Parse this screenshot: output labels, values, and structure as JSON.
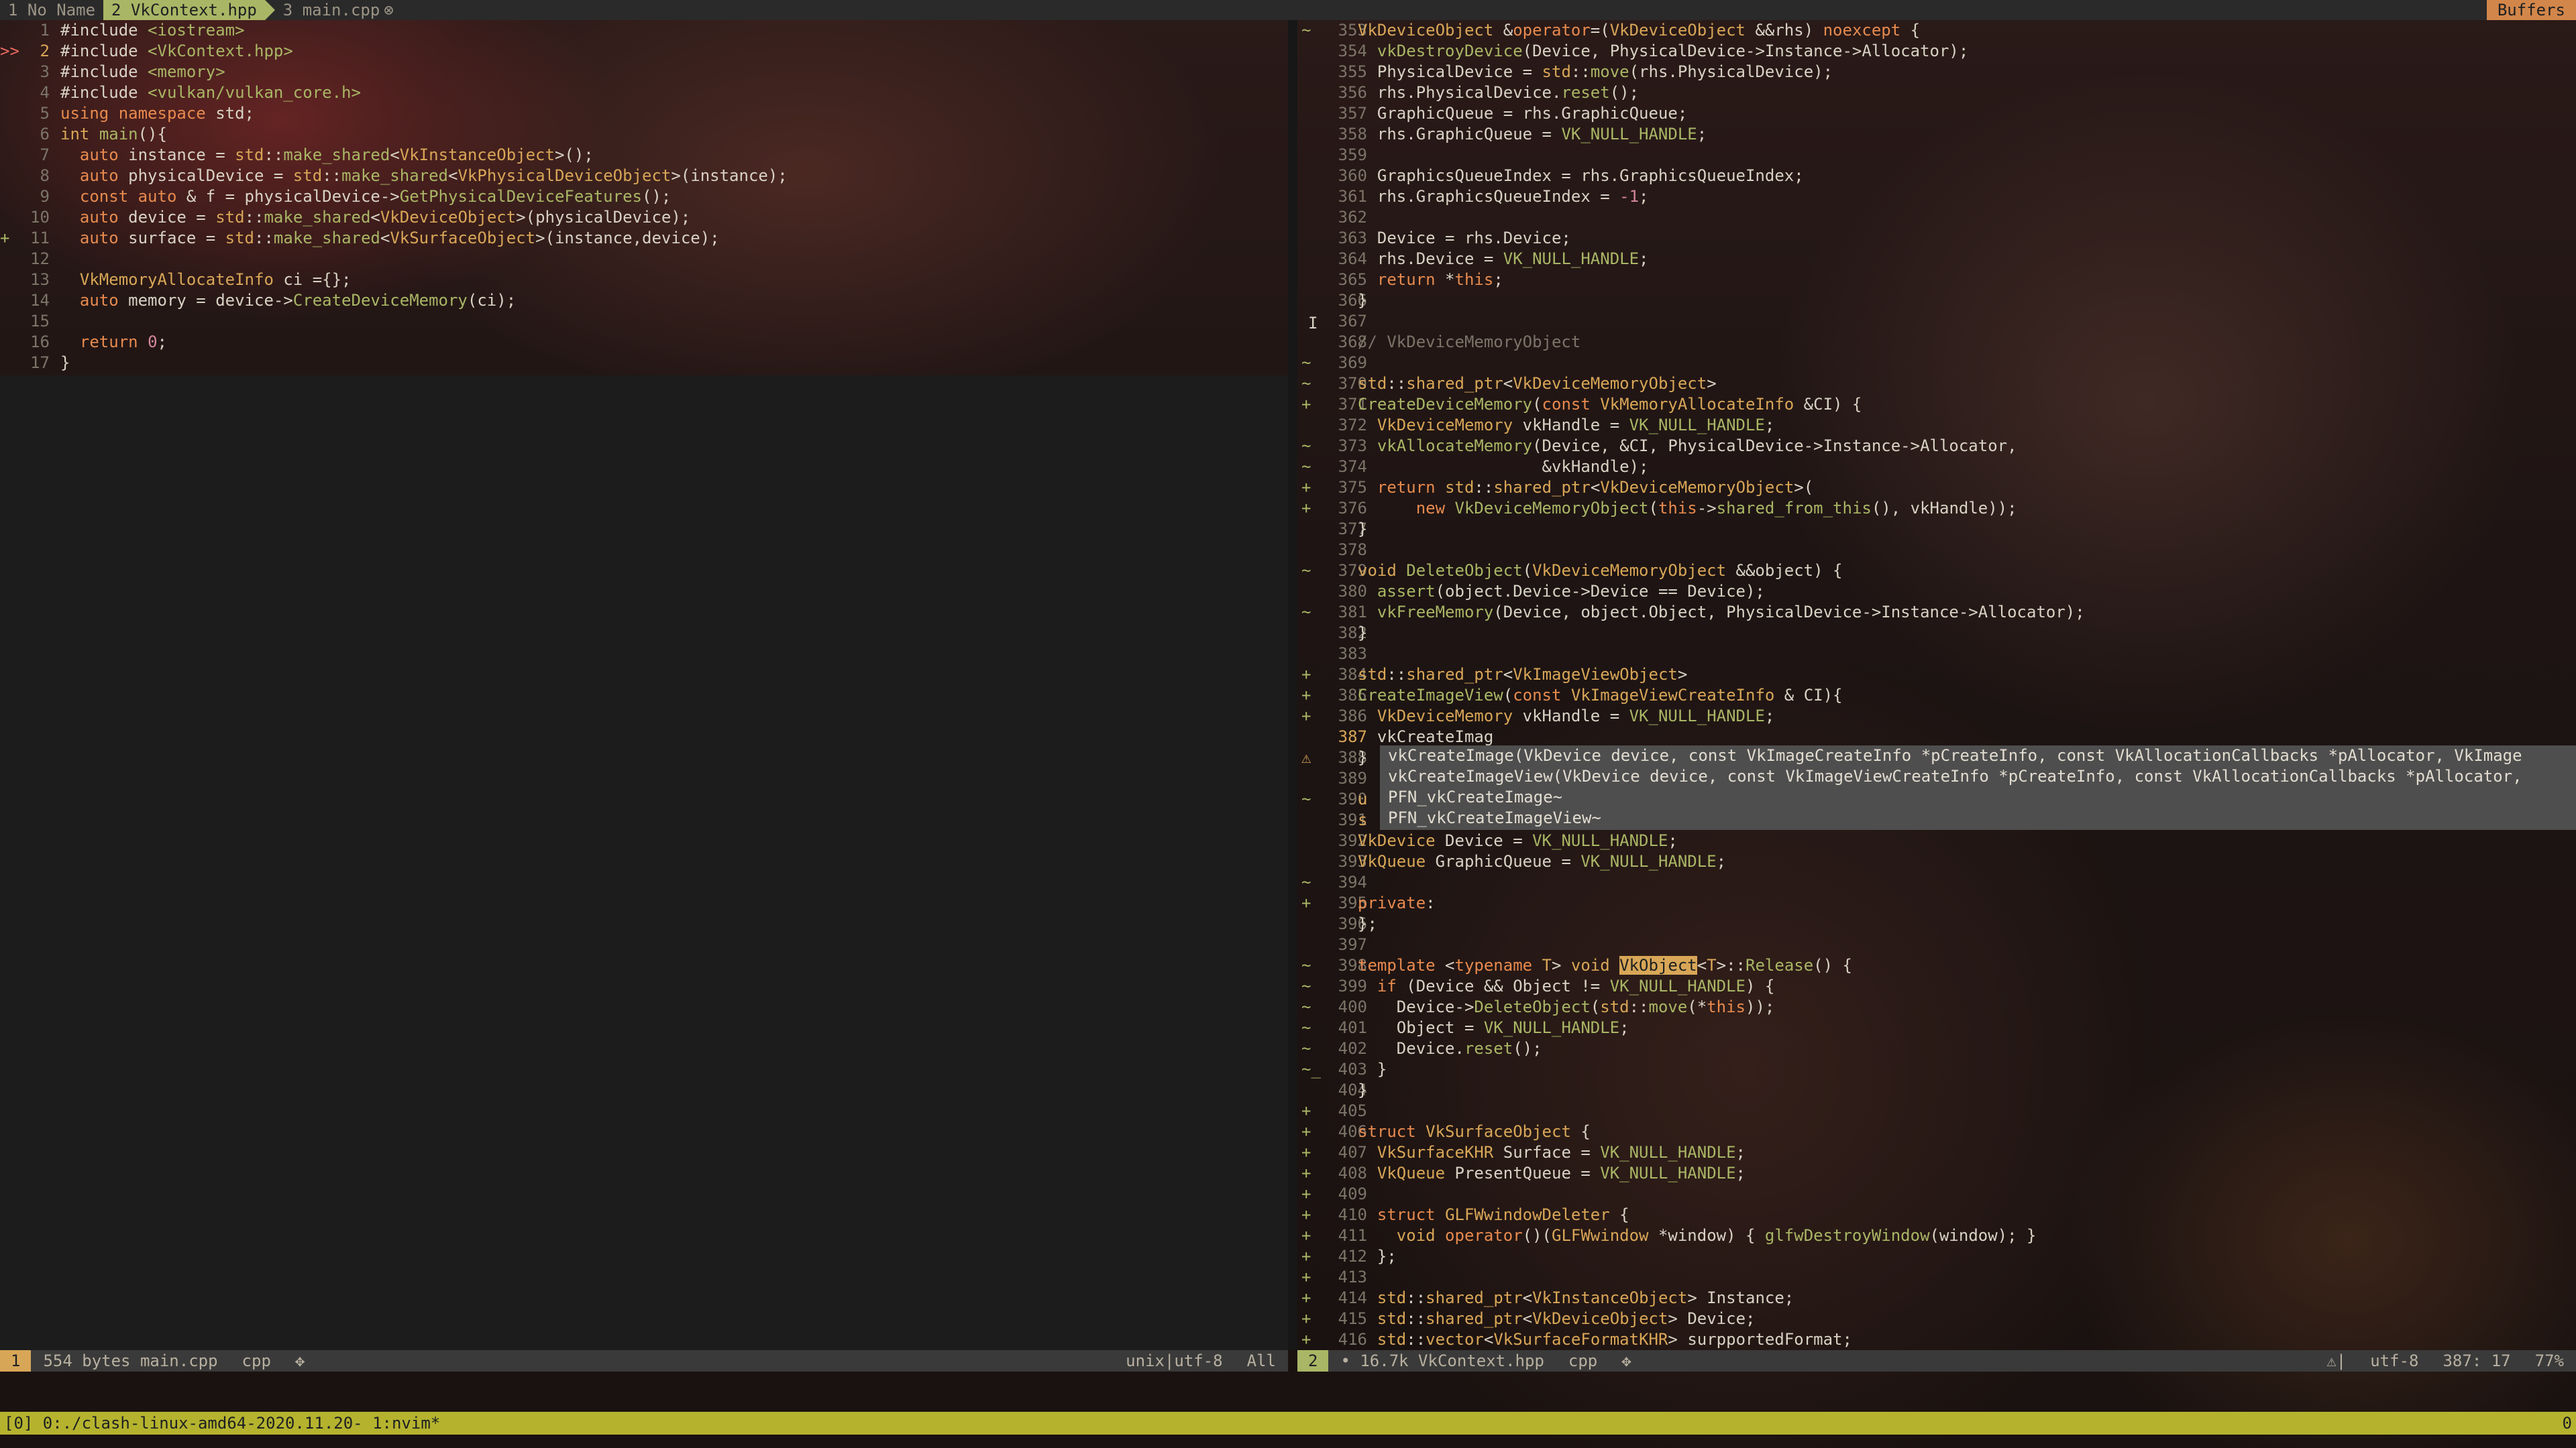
{
  "tabline": {
    "tabs": [
      {
        "label": "1 No Name",
        "active": false
      },
      {
        "label": "2 VkContext.hpp",
        "active": true
      },
      {
        "label": "3 main.cpp",
        "active": false,
        "modified_marker": "⊗"
      }
    ],
    "buffers_label": "Buffers"
  },
  "left_pane": {
    "file": "main.cpp",
    "lines": [
      {
        "n": "1",
        "sign": "",
        "html": "#include <span class=\"s\">&lt;iostream&gt;</span>"
      },
      {
        "n": "2",
        "sign": ">>",
        "cur": true,
        "html": "#include <span class=\"s\">&lt;VkContext.hpp&gt;</span>"
      },
      {
        "n": "3",
        "sign": "",
        "html": "#include <span class=\"s\">&lt;memory&gt;</span>"
      },
      {
        "n": "4",
        "sign": "",
        "html": "#include <span class=\"s\">&lt;vulkan/vulkan_core.h&gt;</span>"
      },
      {
        "n": "5",
        "sign": "",
        "html": "<span class=\"k\">using</span> <span class=\"k\">namespace</span> std;"
      },
      {
        "n": "6",
        "sign": "",
        "html": "<span class=\"t\">int</span> <span class=\"f\">main</span>(){"
      },
      {
        "n": "7",
        "sign": "",
        "html": "  <span class=\"k\">auto</span> instance = <span class=\"t\">std</span>::<span class=\"f\">make_shared</span>&lt;<span class=\"t\">VkInstanceObject</span>&gt;();"
      },
      {
        "n": "8",
        "sign": "",
        "html": "  <span class=\"k\">auto</span> physicalDevice = <span class=\"t\">std</span>::<span class=\"f\">make_shared</span>&lt;<span class=\"t\">VkPhysicalDeviceObject</span>&gt;(instance);"
      },
      {
        "n": "9",
        "sign": "",
        "html": "  <span class=\"k\">const</span> <span class=\"k\">auto</span> &amp; f = physicalDevice-&gt;<span class=\"f\">GetPhysicalDeviceFeatures</span>();"
      },
      {
        "n": "10",
        "sign": "",
        "html": "  <span class=\"k\">auto</span> device = <span class=\"t\">std</span>::<span class=\"f\">make_shared</span>&lt;<span class=\"t\">VkDeviceObject</span>&gt;(physicalDevice);"
      },
      {
        "n": "11",
        "sign": "+",
        "html": "  <span class=\"k\">auto</span> surface = <span class=\"t\">std</span>::<span class=\"f\">make_shared</span>&lt;<span class=\"t\">VkSurfaceObject</span>&gt;(instance,device);"
      },
      {
        "n": "12",
        "sign": "",
        "html": ""
      },
      {
        "n": "13",
        "sign": "",
        "html": "  <span class=\"t\">VkMemoryAllocateInfo</span> ci ={};"
      },
      {
        "n": "14",
        "sign": "",
        "html": "  <span class=\"k\">auto</span> memory = device-&gt;<span class=\"f\">CreateDeviceMemory</span>(ci);"
      },
      {
        "n": "15",
        "sign": "",
        "html": ""
      },
      {
        "n": "16",
        "sign": "",
        "html": "  <span class=\"k\">return</span> <span class=\"n\">0</span>;"
      },
      {
        "n": "17",
        "sign": "",
        "html": "}"
      }
    ]
  },
  "right_pane": {
    "file": "VkContext.hpp",
    "lines": [
      {
        "n": "353",
        "sign": "~",
        "html": "<span class=\"t\">VkDeviceObject</span> &amp;<span class=\"k\">operator</span>=(<span class=\"t\">VkDeviceObject</span> &amp;&amp;rhs) <span class=\"k\">noexcept</span> {"
      },
      {
        "n": "354",
        "sign": "",
        "html": "  <span class=\"f\">vkDestroyDevice</span>(Device, PhysicalDevice-&gt;Instance-&gt;Allocator);"
      },
      {
        "n": "355",
        "sign": "",
        "html": "  PhysicalDevice = <span class=\"t\">std</span>::<span class=\"f\">move</span>(rhs.PhysicalDevice);"
      },
      {
        "n": "356",
        "sign": "",
        "html": "  rhs.PhysicalDevice.<span class=\"f\">reset</span>();"
      },
      {
        "n": "357",
        "sign": "",
        "html": "  GraphicQueue = rhs.GraphicQueue;"
      },
      {
        "n": "358",
        "sign": "",
        "html": "  rhs.GraphicQueue = <span class=\"s\">VK_NULL_HANDLE</span>;"
      },
      {
        "n": "359",
        "sign": "",
        "html": ""
      },
      {
        "n": "360",
        "sign": "",
        "html": "  GraphicsQueueIndex = rhs.GraphicsQueueIndex;"
      },
      {
        "n": "361",
        "sign": "",
        "html": "  rhs.GraphicsQueueIndex = <span class=\"n\">-1</span>;"
      },
      {
        "n": "362",
        "sign": "",
        "html": ""
      },
      {
        "n": "363",
        "sign": "",
        "html": "  Device = rhs.Device;"
      },
      {
        "n": "364",
        "sign": "",
        "html": "  rhs.Device = <span class=\"s\">VK_NULL_HANDLE</span>;"
      },
      {
        "n": "365",
        "sign": "",
        "html": "  <span class=\"k\">return</span> *<span class=\"k\">this</span>;"
      },
      {
        "n": "366",
        "sign": "",
        "html": "}"
      },
      {
        "n": "367",
        "sign": "",
        "html": ""
      },
      {
        "n": "368",
        "sign": "",
        "html": "<span class=\"c\">// VkDeviceMemoryObject</span>"
      },
      {
        "n": "369",
        "sign": "~",
        "html": ""
      },
      {
        "n": "370",
        "sign": "~",
        "html": "<span class=\"t\">std</span>::<span class=\"t\">shared_ptr</span>&lt;<span class=\"t\">VkDeviceMemoryObject</span>&gt;"
      },
      {
        "n": "371",
        "sign": "+",
        "html": "<span class=\"f\">CreateDeviceMemory</span>(<span class=\"k\">const</span> <span class=\"t\">VkMemoryAllocateInfo</span> &amp;CI) {"
      },
      {
        "n": "372",
        "sign": "",
        "html": "  <span class=\"t\">VkDeviceMemory</span> vkHandle = <span class=\"s\">VK_NULL_HANDLE</span>;"
      },
      {
        "n": "373",
        "sign": "~",
        "html": "  <span class=\"f\">vkAllocateMemory</span>(Device, &amp;CI, PhysicalDevice-&gt;Instance-&gt;Allocator,"
      },
      {
        "n": "374",
        "sign": "~",
        "html": "                   &amp;vkHandle);"
      },
      {
        "n": "375",
        "sign": "+",
        "html": "  <span class=\"k\">return</span> <span class=\"t\">std</span>::<span class=\"t\">shared_ptr</span>&lt;<span class=\"t\">VkDeviceMemoryObject</span>&gt;("
      },
      {
        "n": "376",
        "sign": "+",
        "html": "      <span class=\"k\">new</span> <span class=\"f\">VkDeviceMemoryObject</span>(<span class=\"k\">this</span>-&gt;<span class=\"f\">shared_from_this</span>(), vkHandle));"
      },
      {
        "n": "377",
        "sign": "",
        "html": "}"
      },
      {
        "n": "378",
        "sign": "",
        "html": ""
      },
      {
        "n": "379",
        "sign": "~",
        "html": "<span class=\"t\">void</span> <span class=\"f\">DeleteObject</span>(<span class=\"t\">VkDeviceMemoryObject</span> &amp;&amp;object) {"
      },
      {
        "n": "380",
        "sign": "",
        "html": "  <span class=\"f\">assert</span>(object.Device-&gt;Device == Device);"
      },
      {
        "n": "381",
        "sign": "~",
        "html": "  <span class=\"f\">vkFreeMemory</span>(Device, object.Object, PhysicalDevice-&gt;Instance-&gt;Allocator);"
      },
      {
        "n": "382",
        "sign": "",
        "html": "}"
      },
      {
        "n": "383",
        "sign": "",
        "html": ""
      },
      {
        "n": "384",
        "sign": "+",
        "html": "<span class=\"t\">std</span>::<span class=\"t\">shared_ptr</span>&lt;<span class=\"t\">VkImageViewObject</span>&gt;"
      },
      {
        "n": "385",
        "sign": "+",
        "html": "<span class=\"f\">CreateImageView</span>(<span class=\"k\">const</span> <span class=\"t\">VkImageViewCreateInfo</span> &amp; CI){"
      },
      {
        "n": "386",
        "sign": "+",
        "html": "  <span class=\"t\">VkDeviceMemory</span> vkHandle = <span class=\"s\">VK_NULL_HANDLE</span>;"
      },
      {
        "n": "387",
        "sign": "",
        "cur": true,
        "html": "  vkCreateImag"
      },
      {
        "n": "388",
        "sign": "⚠",
        "html": "}"
      },
      {
        "n": "389",
        "sign": "",
        "html": ""
      },
      {
        "n": "390",
        "sign": "~",
        "html": "<span class=\"t\">u</span>"
      },
      {
        "n": "391",
        "sign": "",
        "html": "<span class=\"t\">s</span>"
      },
      {
        "n": "392",
        "sign": "",
        "html": "<span class=\"t\">VkDevice</span> Device = <span class=\"s\">VK_NULL_HANDLE</span>;"
      },
      {
        "n": "393",
        "sign": "",
        "html": "<span class=\"t\">VkQueue</span> GraphicQueue = <span class=\"s\">VK_NULL_HANDLE</span>;"
      },
      {
        "n": "394",
        "sign": "~",
        "html": ""
      },
      {
        "n": "395",
        "sign": "+",
        "html": "<span class=\"k\">private</span>:"
      },
      {
        "n": "396",
        "sign": "",
        "html": "};"
      },
      {
        "n": "397",
        "sign": "",
        "html": ""
      },
      {
        "n": "398",
        "sign": "~",
        "html": "<span class=\"k\">template</span> &lt;<span class=\"k\">typename</span> <span class=\"t\">T</span>&gt; <span class=\"t\">void</span> <span class=\"hl\">VkObject</span>&lt;<span class=\"t\">T</span>&gt;::<span class=\"f\">Release</span>() {"
      },
      {
        "n": "399",
        "sign": "~",
        "html": "  <span class=\"k\">if</span> (Device &amp;&amp; Object != <span class=\"s\">VK_NULL_HANDLE</span>) {"
      },
      {
        "n": "400",
        "sign": "~",
        "html": "    Device-&gt;<span class=\"f\">DeleteObject</span>(<span class=\"t\">std</span>::<span class=\"f\">move</span>(*<span class=\"k\">this</span>));"
      },
      {
        "n": "401",
        "sign": "~",
        "html": "    Object = <span class=\"s\">VK_NULL_HANDLE</span>;"
      },
      {
        "n": "402",
        "sign": "~",
        "html": "    Device.<span class=\"f\">reset</span>();"
      },
      {
        "n": "403",
        "sign": "~_",
        "html": "  }"
      },
      {
        "n": "404",
        "sign": "",
        "html": "}"
      },
      {
        "n": "405",
        "sign": "+",
        "html": ""
      },
      {
        "n": "406",
        "sign": "+",
        "html": "<span class=\"k\">struct</span> <span class=\"t\">VkSurfaceObject</span> {"
      },
      {
        "n": "407",
        "sign": "+",
        "html": "  <span class=\"t\">VkSurfaceKHR</span> Surface = <span class=\"s\">VK_NULL_HANDLE</span>;"
      },
      {
        "n": "408",
        "sign": "+",
        "html": "  <span class=\"t\">VkQueue</span> PresentQueue = <span class=\"s\">VK_NULL_HANDLE</span>;"
      },
      {
        "n": "409",
        "sign": "+",
        "html": ""
      },
      {
        "n": "410",
        "sign": "+",
        "html": "  <span class=\"k\">struct</span> <span class=\"t\">GLFWwindowDeleter</span> {"
      },
      {
        "n": "411",
        "sign": "+",
        "html": "    <span class=\"t\">void</span> <span class=\"k\">operator</span>()(<span class=\"t\">GLFWwindow</span> *window) { <span class=\"f\">glfwDestroyWindow</span>(window); }"
      },
      {
        "n": "412",
        "sign": "+",
        "html": "  };"
      },
      {
        "n": "413",
        "sign": "+",
        "html": ""
      },
      {
        "n": "414",
        "sign": "+",
        "html": "  <span class=\"t\">std</span>::<span class=\"t\">shared_ptr</span>&lt;<span class=\"t\">VkInstanceObject</span>&gt; Instance;"
      },
      {
        "n": "415",
        "sign": "+",
        "html": "  <span class=\"t\">std</span>::<span class=\"t\">shared_ptr</span>&lt;<span class=\"t\">VkDeviceObject</span>&gt; Device;"
      },
      {
        "n": "416",
        "sign": "+",
        "html": "  <span class=\"t\">std</span>::<span class=\"t\">vector</span>&lt;<span class=\"t\">VkSurfaceFormatKHR</span>&gt; surpportedFormat;"
      }
    ]
  },
  "completion_popup": {
    "items": [
      "vkCreateImage(VkDevice device, const VkImageCreateInfo *pCreateInfo, const VkAllocationCallbacks *pAllocator, VkImage",
      "vkCreateImageView(VkDevice device, const VkImageViewCreateInfo *pCreateInfo, const VkAllocationCallbacks *pAllocator,",
      "PFN_vkCreateImage~",
      "PFN_vkCreateImageView~"
    ]
  },
  "status_left": {
    "win_num": "1",
    "info": "554 bytes main.cpp",
    "filetype": "cpp",
    "icon": "✥",
    "encoding": "unix|utf-8",
    "position": "All"
  },
  "status_right": {
    "win_num": "2",
    "info": "• 16.7k VkContext.hpp",
    "filetype": "cpp",
    "icon": "✥",
    "warn": "⚠|",
    "encoding": "utf-8",
    "cursor": "387: 17",
    "percent": "77%"
  },
  "tmux": {
    "left": "[0] 0:./clash-linux-amd64-2020.11.20- 1:nvim*",
    "right": "0"
  },
  "colors": {
    "accent_green": "#a9b665",
    "accent_yellow": "#d8a657",
    "accent_orange": "#e78a4e",
    "tmux_bar": "#b5b32e"
  }
}
